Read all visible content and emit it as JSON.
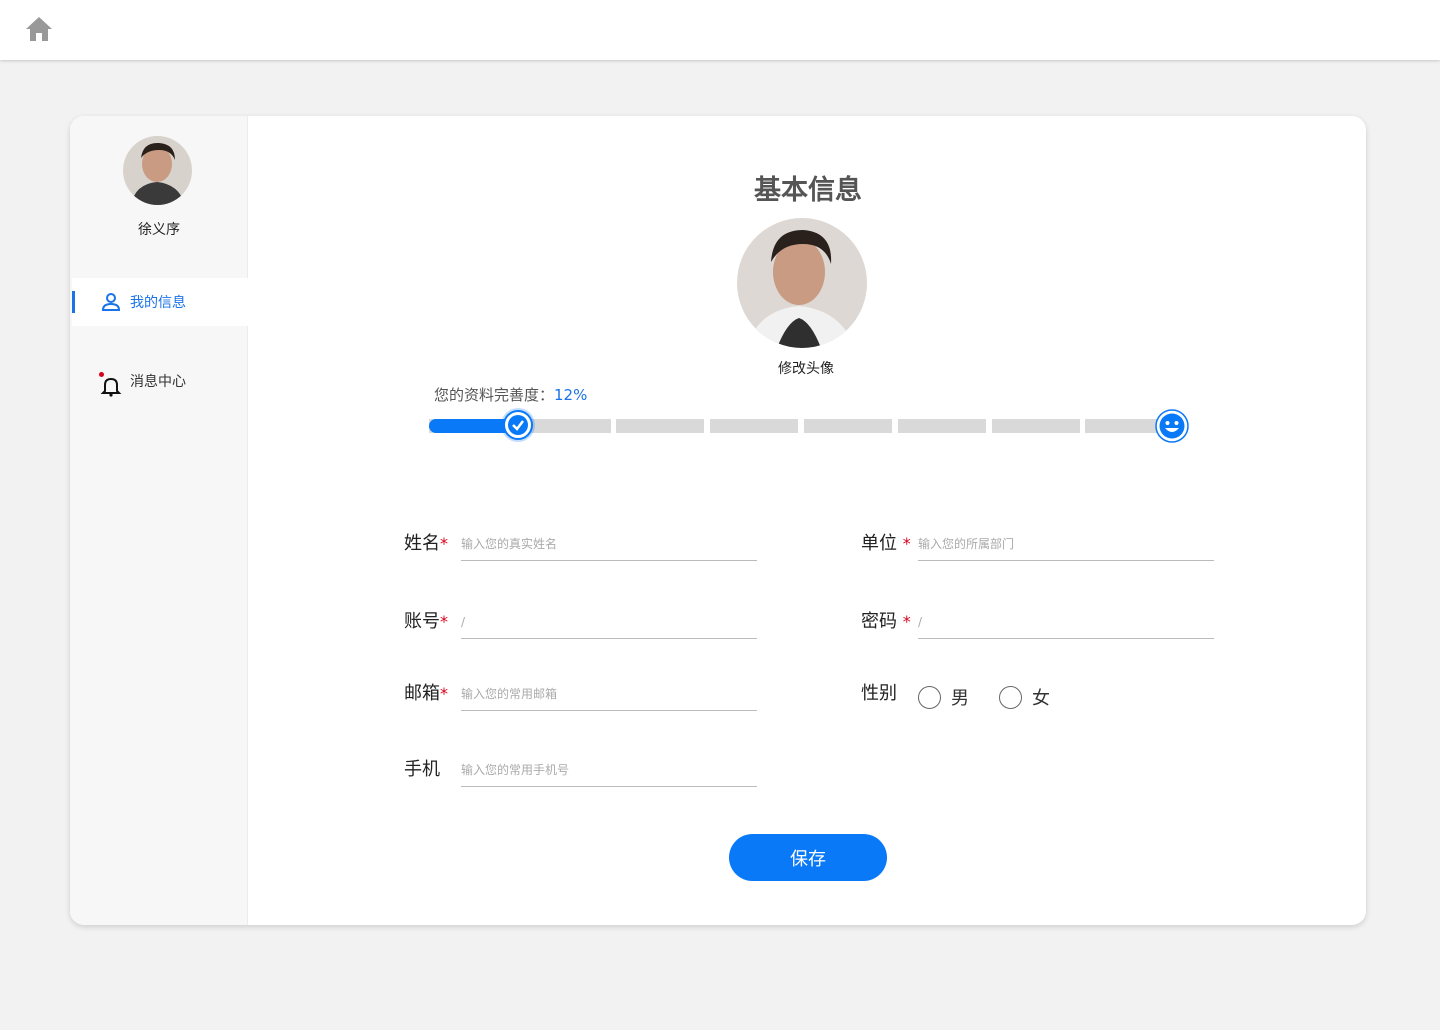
{
  "colors": {
    "accent": "#0a79f7",
    "required": "#d9001b",
    "page_bg": "#f2f2f2"
  },
  "topbar": {
    "home_icon": "home-icon"
  },
  "sidebar": {
    "user_name": "徐义序",
    "items": [
      {
        "label": "我的信息",
        "icon": "user-icon",
        "active": true
      },
      {
        "label": "消息中心",
        "icon": "bell-icon",
        "active": false,
        "has_unread_dot": true
      }
    ]
  },
  "main": {
    "title": "基本信息",
    "change_avatar": "修改头像",
    "progress": {
      "label": "您的资料完善度：",
      "value": "12%",
      "fraction": 0.12
    },
    "fields": {
      "name": {
        "label": "姓名",
        "required": "*",
        "placeholder": "输入您的真实姓名"
      },
      "unit": {
        "label": "单位",
        "required": "*",
        "placeholder": "输入您的所属部门"
      },
      "account": {
        "label": "账号",
        "required": "*",
        "value": "/"
      },
      "password": {
        "label": "密码",
        "required": "*",
        "value": "/"
      },
      "email": {
        "label": "邮箱",
        "required": "*",
        "placeholder": "输入您的常用邮箱"
      },
      "gender": {
        "label": "性别",
        "options": [
          "男",
          "女"
        ]
      },
      "phone": {
        "label": "手机",
        "placeholder": "输入您的常用手机号"
      }
    },
    "save_label": "保存"
  }
}
